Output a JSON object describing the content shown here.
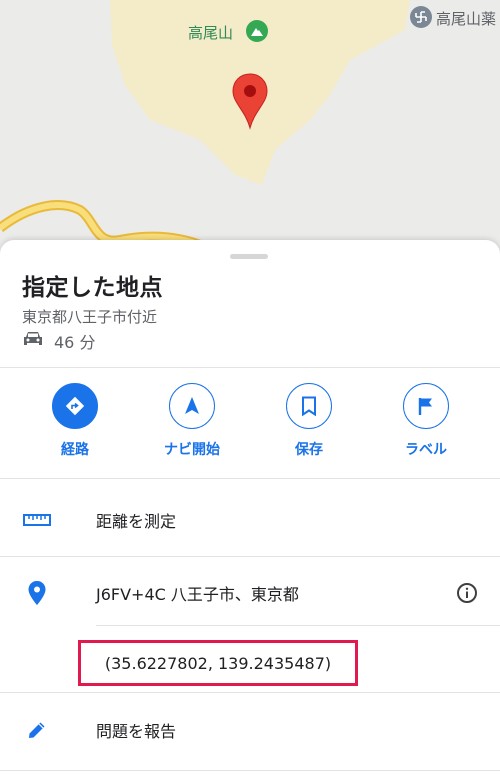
{
  "map": {
    "peak_label": "高尾山",
    "temple_label": "高尾山薬",
    "pin_color": "#ea4335",
    "peak_icon": "mountain-peak-icon",
    "temple_icon": "temple-icon"
  },
  "place": {
    "title": "指定した地点",
    "address": "東京都八王子市付近",
    "drive_icon": "car-icon",
    "drive_time": "46 分"
  },
  "actions": [
    {
      "label": "経路",
      "icon": "directions-icon"
    },
    {
      "label": "ナビ開始",
      "icon": "navigation-arrow-icon"
    },
    {
      "label": "保存",
      "icon": "bookmark-icon"
    },
    {
      "label": "ラベル",
      "icon": "flag-icon"
    }
  ],
  "rows": {
    "measure": {
      "label": "距離を測定",
      "icon": "ruler-icon"
    },
    "plus_code": {
      "label": "J6FV+4C 八王子市、東京都",
      "icon": "location-pin-icon",
      "info_icon": "info-icon"
    },
    "coordinates": {
      "label": "(35.6227802, 139.2435487)"
    },
    "report": {
      "label": "問題を報告",
      "icon": "pencil-icon"
    }
  },
  "colors": {
    "accent": "#1a73e8",
    "highlight_border": "#e0194f",
    "park_area": "#f4ebc9",
    "road": "#f6cf4a"
  }
}
